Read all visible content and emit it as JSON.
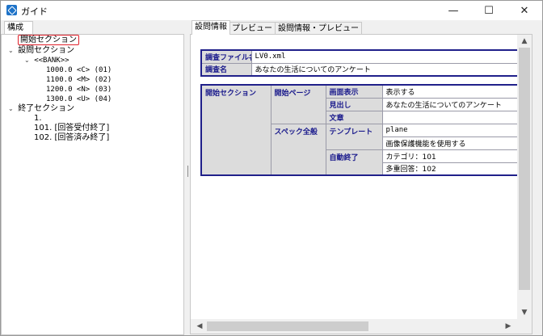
{
  "window": {
    "title": "ガイド",
    "minimize_glyph": "—",
    "maximize_glyph": "☐",
    "close_glyph": "✕"
  },
  "left": {
    "tab_label": "構成",
    "tree": {
      "start": "開始セクション",
      "question": "設問セクション",
      "bank": "<<BANK>>",
      "options": [
        "1000.0 <C> (01)",
        "1100.0 <M> (02)",
        "1200.0 <N> (03)",
        "1300.0 <U> (04)"
      ],
      "end": "終了セクション",
      "end_items": [
        "1.",
        "101. [回答受付終了]",
        "102. [回答済み終了]"
      ],
      "toggle_glyph": "⌄"
    }
  },
  "right": {
    "tabs": [
      "設問情報",
      "プレビュー",
      "設問情報・プレビュー"
    ],
    "active_tab": "設問情報",
    "file_table": {
      "rows": [
        {
          "label": "調査ファイル名",
          "value": "LV0.xml"
        },
        {
          "label": "調査名",
          "value": "あなたの生活についてのアンケート"
        }
      ]
    },
    "section_table": {
      "section": "開始セクション",
      "groups": [
        {
          "name": "開始ページ",
          "items": [
            {
              "key": "画面表示",
              "value": "表示する"
            },
            {
              "key": "見出し",
              "value": "あなたの生活についてのアンケート"
            },
            {
              "key": "文章",
              "value": ""
            }
          ]
        },
        {
          "name": "スペック全般",
          "items": [
            {
              "key": "テンプレート",
              "value": "plane"
            },
            {
              "key": "",
              "value": "画像保護機能を使用する"
            },
            {
              "key": "自動終了",
              "value": "カテゴリ：101"
            },
            {
              "key": "",
              "value": "多重回答：102"
            }
          ]
        }
      ]
    },
    "scroll": {
      "up": "▲",
      "down": "▼",
      "left": "◀",
      "right": "▶"
    }
  },
  "colors": {
    "table_border": "#20208a",
    "header_text": "#1a1a8c",
    "header_bg": "#dcdcdc",
    "selection_border": "#e0202a",
    "app_icon": "#1e73c8"
  }
}
